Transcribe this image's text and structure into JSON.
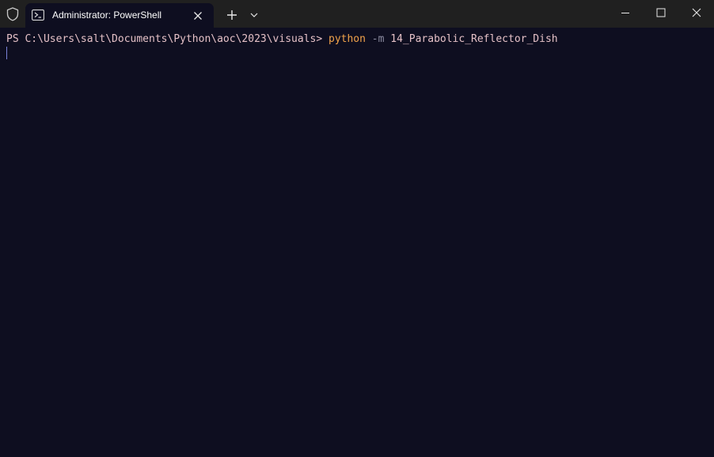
{
  "window": {
    "tab_title": "Administrator: PowerShell",
    "icons": {
      "shield": "shield-icon",
      "tab": "powershell-icon",
      "close_tab": "close-icon",
      "new_tab": "plus-icon",
      "dropdown": "chevron-down-icon",
      "minimize": "minimize-icon",
      "maximize": "maximize-icon",
      "close_window": "close-icon"
    }
  },
  "terminal": {
    "prompt": "PS C:\\Users\\salt\\Documents\\Python\\aoc\\2023\\visuals> ",
    "command": "python",
    "flag": " -m ",
    "argument": "14_Parabolic_Reflector_Dish"
  },
  "colors": {
    "background": "#0e0e20",
    "titlebar": "#202020",
    "prompt_text": "#e4c0c6",
    "command_text": "#f0a24a",
    "flag_text": "#8c8ca0",
    "cursor": "#7a82d8"
  }
}
